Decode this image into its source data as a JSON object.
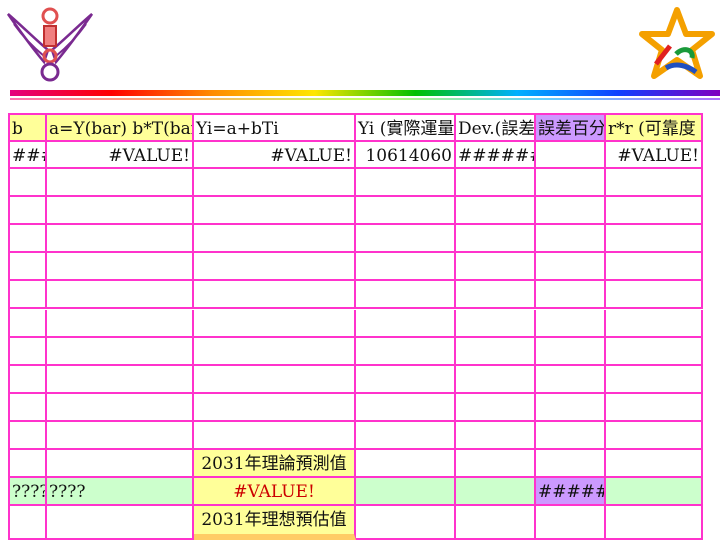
{
  "header_row": {
    "c0": "b",
    "c1": "a=Y(bar) b*T(bar)",
    "c2": "Yi=a+bTi",
    "c3": "Yi (實際運量",
    "c4": "Dev.(誤差",
    "c5": "誤差百分",
    "c6": "r*r (可靠度"
  },
  "row1": {
    "c0": "###",
    "c1": "#VALUE!",
    "c2": "#VALUE!",
    "c3": "10614060",
    "c4": "######",
    "c6": "#VALUE!"
  },
  "theory_label": "2031年理論預測值",
  "theory_row": {
    "c0": "????",
    "c1": "????",
    "c2": "#VALUE!",
    "c5": "######"
  },
  "ideal_label": "2031年理想預估值",
  "colors": {
    "grid": "#ff33cc",
    "yellow": "#ffff99",
    "purple": "#cc99ff",
    "green": "#ccffcc",
    "orange": "#ffcc66"
  },
  "icons": {
    "left_logo": "winged-emblem-logo",
    "right_logo": "star-logo"
  }
}
